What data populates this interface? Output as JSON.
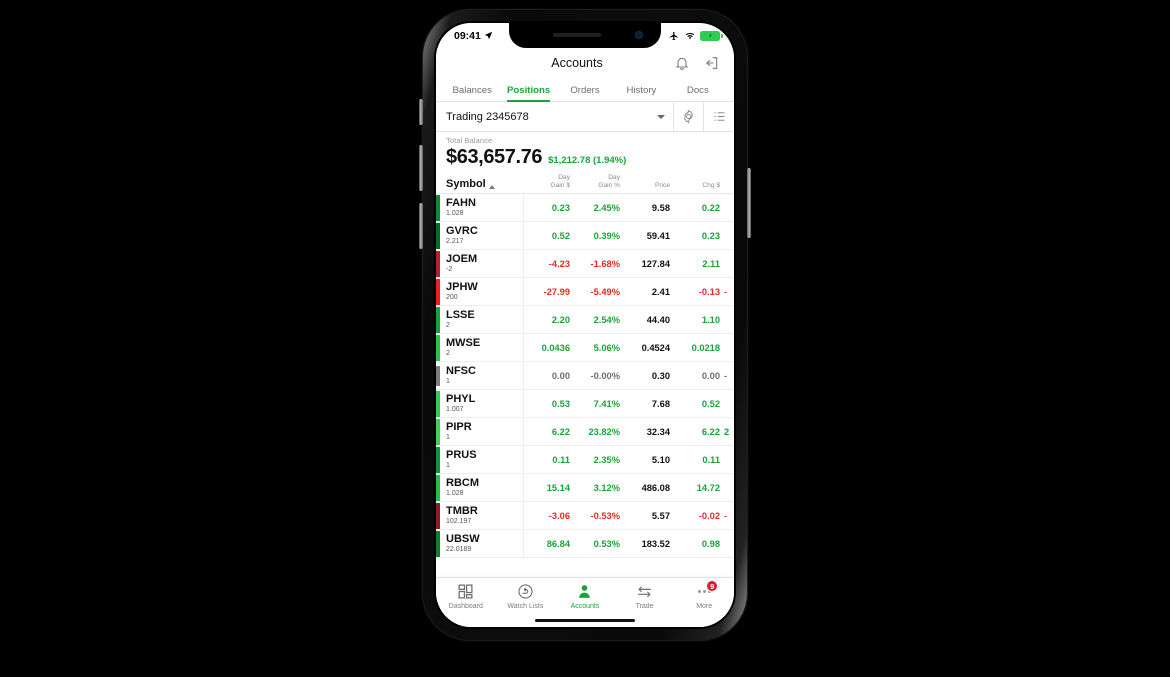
{
  "status_bar": {
    "time": "09:41",
    "icons": [
      "location-arrow-icon",
      "airplane-mode-icon",
      "wifi-icon",
      "battery-charging-icon"
    ]
  },
  "header": {
    "title": "Accounts",
    "notification_icon": "bell-icon",
    "logout_icon": "logout-icon"
  },
  "tabs": [
    {
      "label": "Balances",
      "active": false
    },
    {
      "label": "Positions",
      "active": true
    },
    {
      "label": "Orders",
      "active": false
    },
    {
      "label": "History",
      "active": false
    },
    {
      "label": "Docs",
      "active": false
    }
  ],
  "account_selector": {
    "value": "Trading 2345678",
    "caret_icon": "chevron-down-icon",
    "settings_icon": "gear-icon",
    "list_icon": "list-view-icon"
  },
  "balance": {
    "label": "Total Balance",
    "amount": "$63,657.76",
    "change": "$1,212.78 (1.94%)",
    "change_positive": true
  },
  "table": {
    "columns": [
      {
        "key": "symbol",
        "label": "Symbol",
        "sorted": true,
        "sort_dir": "asc"
      },
      {
        "key": "day_gain_dollar",
        "label_top": "Day",
        "label_bottom": "Gain $"
      },
      {
        "key": "day_gain_percent",
        "label_top": "Day",
        "label_bottom": "Gain %"
      },
      {
        "key": "price",
        "label_bottom": "Price"
      },
      {
        "key": "chg_dollar",
        "label_bottom": "Chg $"
      }
    ],
    "rows": [
      {
        "symbol": "FAHN",
        "qty": "1.028",
        "day_gain_dollar": "0.23",
        "day_gain_percent": "2.45%",
        "price": "9.58",
        "chg_dollar": "0.22",
        "extra": "",
        "dir": "up",
        "bar_color": "#0d8b2e"
      },
      {
        "symbol": "GVRC",
        "qty": "2.217",
        "day_gain_dollar": "0.52",
        "day_gain_percent": "0.39%",
        "price": "59.41",
        "chg_dollar": "0.23",
        "extra": "",
        "dir": "up",
        "bar_color": "#0a6b24"
      },
      {
        "symbol": "JOEM",
        "qty": "-2",
        "day_gain_dollar": "-4.23",
        "day_gain_percent": "-1.68%",
        "price": "127.84",
        "chg_dollar": "2.11",
        "extra": "",
        "dir": "down",
        "bar_color": "#b3222a",
        "chg_dir": "up"
      },
      {
        "symbol": "JPHW",
        "qty": "200",
        "day_gain_dollar": "-27.99",
        "day_gain_percent": "-5.49%",
        "price": "2.41",
        "chg_dollar": "-0.13",
        "extra": "-",
        "dir": "down",
        "bar_color": "#ee1c25"
      },
      {
        "symbol": "LSSE",
        "qty": "2",
        "day_gain_dollar": "2.20",
        "day_gain_percent": "2.54%",
        "price": "44.40",
        "chg_dollar": "1.10",
        "extra": "",
        "dir": "up",
        "bar_color": "#17a23a"
      },
      {
        "symbol": "MWSE",
        "qty": "2",
        "day_gain_dollar": "0.0436",
        "day_gain_percent": "5.06%",
        "price": "0.4524",
        "chg_dollar": "0.0218",
        "extra": "",
        "dir": "up",
        "bar_color": "#2bc04c"
      },
      {
        "symbol": "NFSC",
        "qty": "1",
        "day_gain_dollar": "0.00",
        "day_gain_percent": "-0.00%",
        "price": "0.30",
        "chg_dollar": "0.00",
        "extra": "-",
        "dir": "neutral",
        "bar_color": "#7d7d7d"
      },
      {
        "symbol": "PHYL",
        "qty": "1.007",
        "day_gain_dollar": "0.53",
        "day_gain_percent": "7.41%",
        "price": "7.68",
        "chg_dollar": "0.52",
        "extra": "",
        "dir": "up",
        "bar_color": "#34c759"
      },
      {
        "symbol": "PIPR",
        "qty": "1",
        "day_gain_dollar": "6.22",
        "day_gain_percent": "23.82%",
        "price": "32.34",
        "chg_dollar": "6.22",
        "extra": "2",
        "dir": "up",
        "bar_color": "#3ad15f"
      },
      {
        "symbol": "PRUS",
        "qty": "1",
        "day_gain_dollar": "0.11",
        "day_gain_percent": "2.35%",
        "price": "5.10",
        "chg_dollar": "0.11",
        "extra": "",
        "dir": "up",
        "bar_color": "#109434"
      },
      {
        "symbol": "RBCM",
        "qty": "1.028",
        "day_gain_dollar": "15.14",
        "day_gain_percent": "3.12%",
        "price": "486.08",
        "chg_dollar": "14.72",
        "extra": "",
        "dir": "up",
        "bar_color": "#2aba4c"
      },
      {
        "symbol": "TMBR",
        "qty": "102.197",
        "day_gain_dollar": "-3.06",
        "day_gain_percent": "-0.53%",
        "price": "5.57",
        "chg_dollar": "-0.02",
        "extra": "-",
        "dir": "down",
        "bar_color": "#8c1b22"
      },
      {
        "symbol": "UBSW",
        "qty": "22.0189",
        "day_gain_dollar": "86.84",
        "day_gain_percent": "0.53%",
        "price": "183.52",
        "chg_dollar": "0.98",
        "extra": "",
        "dir": "up",
        "bar_color": "#0f7f2c"
      }
    ]
  },
  "bottom_nav": [
    {
      "label": "Dashboard",
      "icon": "dashboard-grid-icon",
      "active": false,
      "badge": null
    },
    {
      "label": "Watch Lists",
      "icon": "watchlist-icon",
      "active": false,
      "badge": null
    },
    {
      "label": "Accounts",
      "icon": "person-icon",
      "active": true,
      "badge": null
    },
    {
      "label": "Trade",
      "icon": "trade-arrows-icon",
      "active": false,
      "badge": null
    },
    {
      "label": "More",
      "icon": "more-dots-icon",
      "active": false,
      "badge": "9"
    }
  ],
  "colors": {
    "accent_green": "#1aa338",
    "down_red": "#e02b27",
    "badge_red": "#e8192c"
  }
}
